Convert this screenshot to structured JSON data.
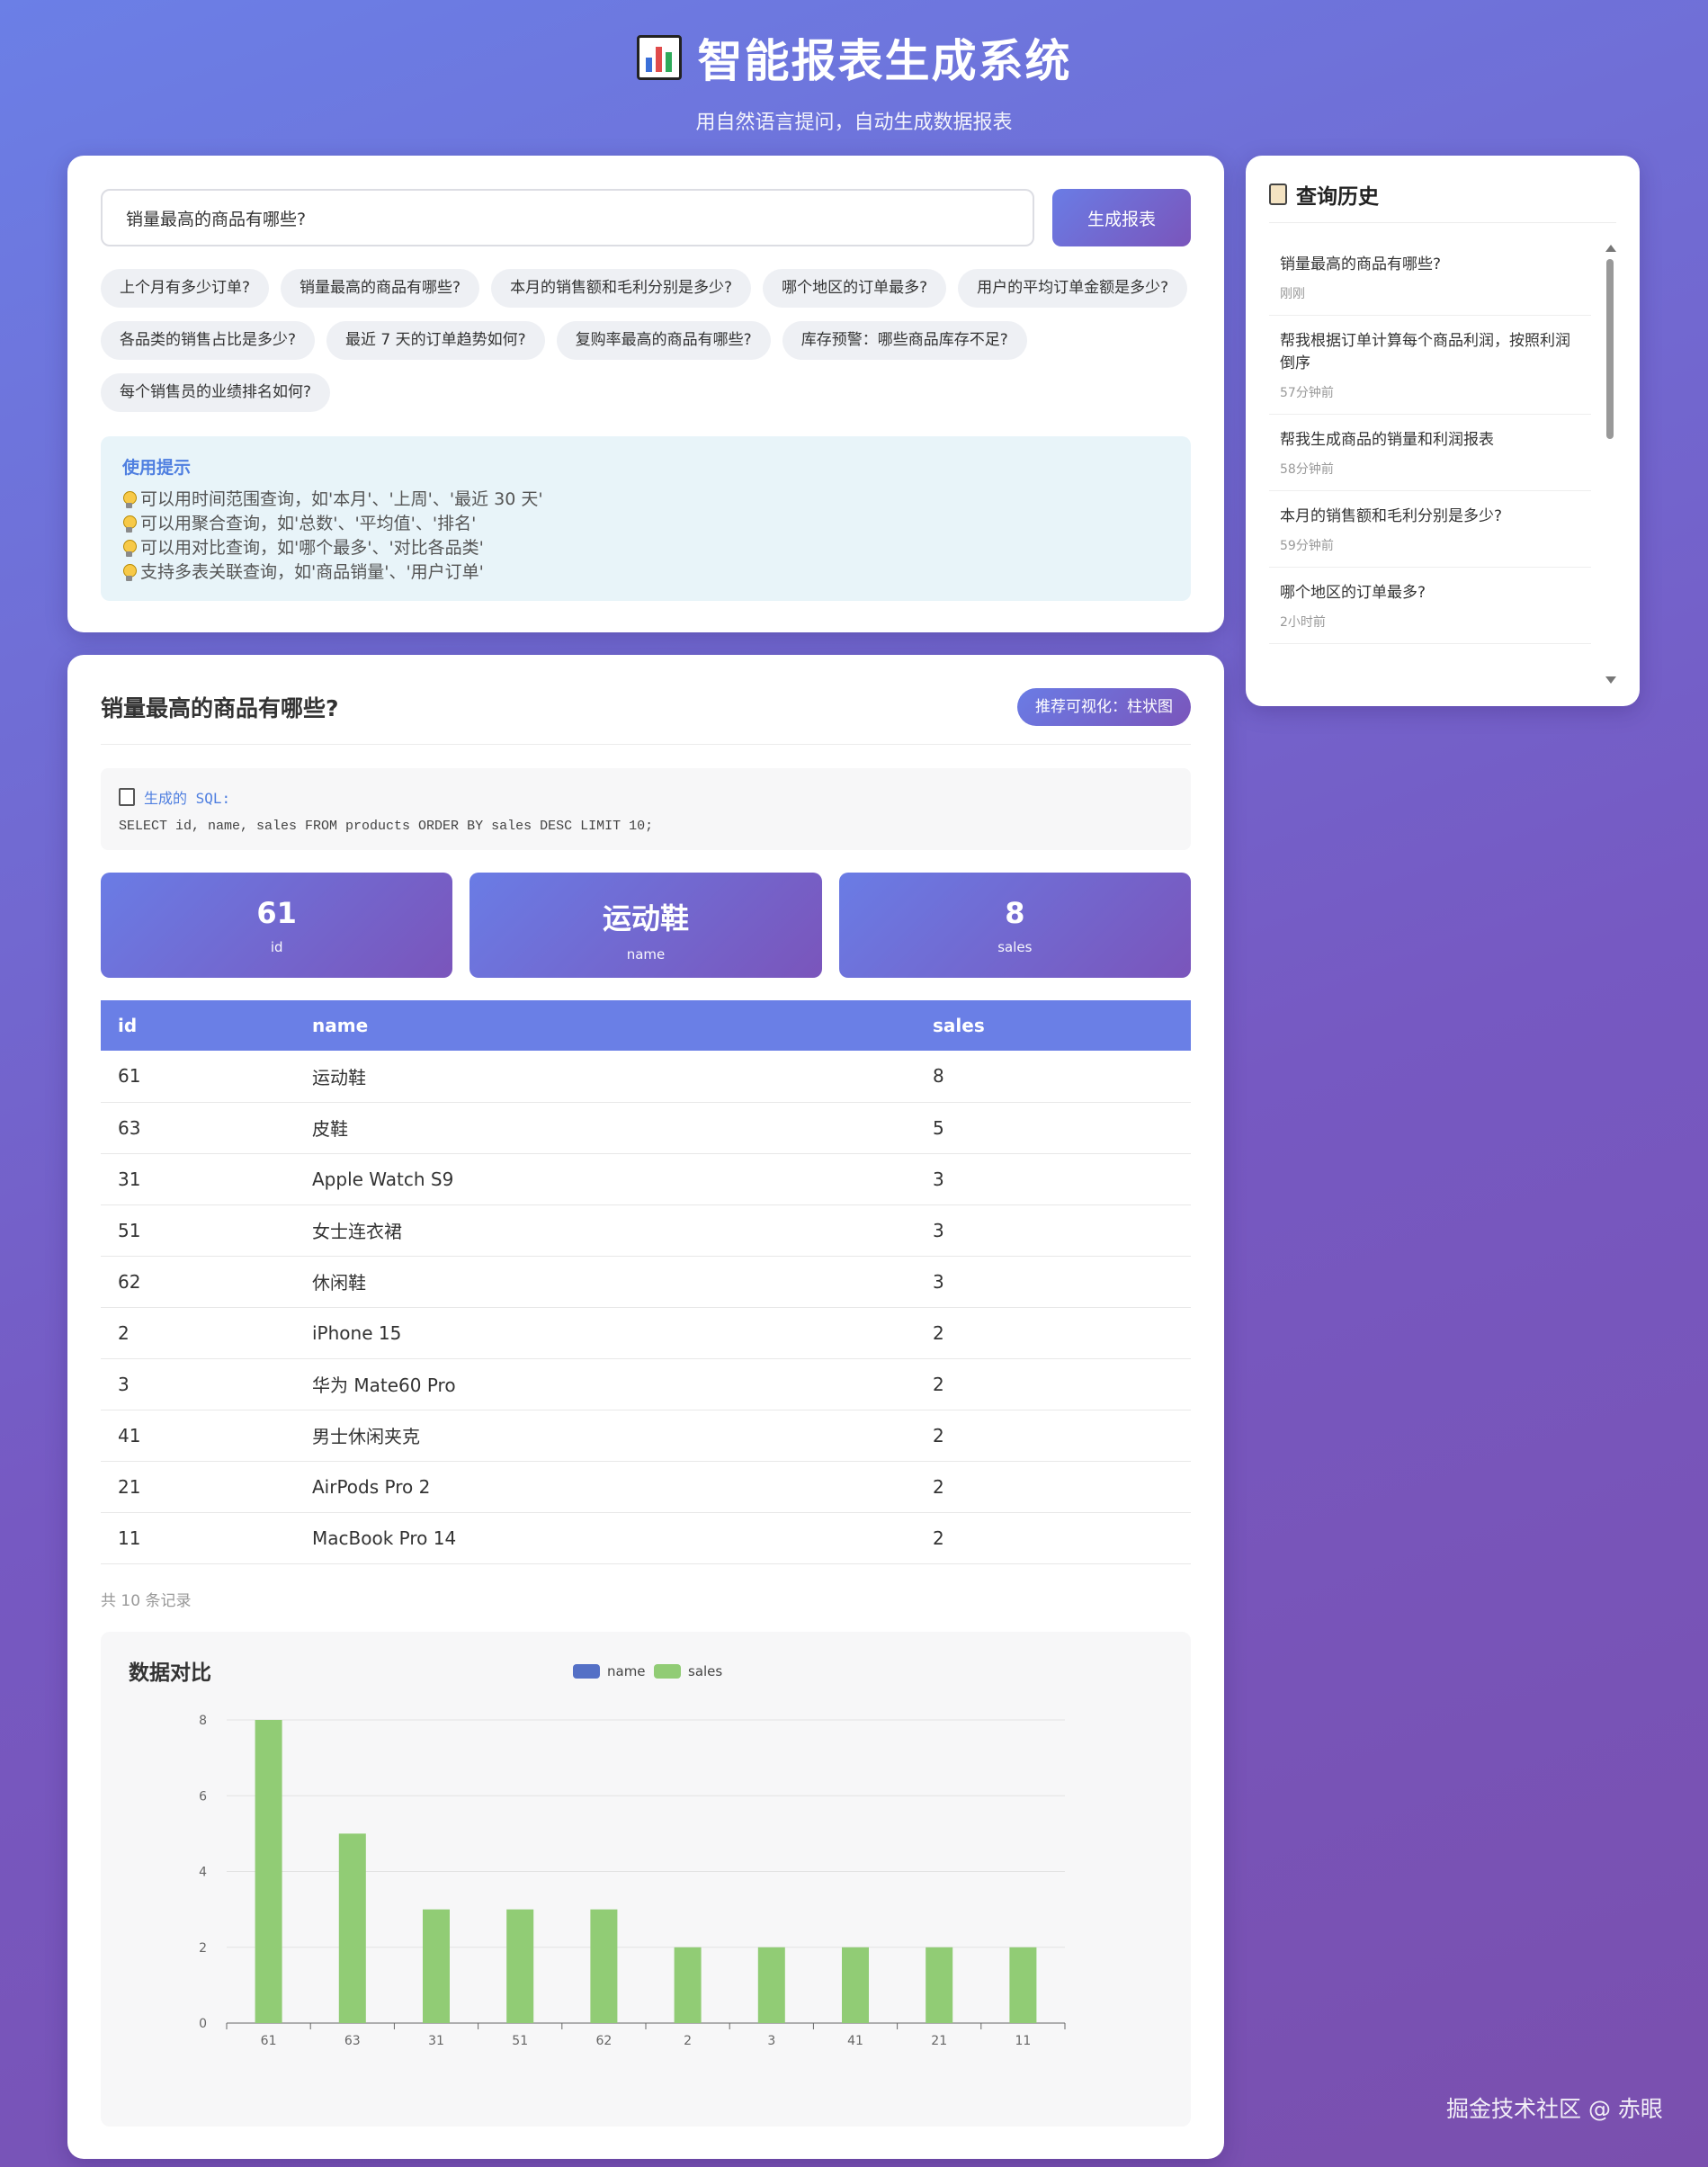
{
  "header": {
    "title": "智能报表生成系统",
    "subtitle": "用自然语言提问，自动生成数据报表"
  },
  "query": {
    "input_value": "销量最高的商品有哪些?",
    "generate_label": "生成报表",
    "suggestions": [
      "上个月有多少订单?",
      "销量最高的商品有哪些?",
      "本月的销售额和毛利分别是多少?",
      "哪个地区的订单最多?",
      "用户的平均订单金额是多少?",
      "各品类的销售占比是多少?",
      "最近 7 天的订单趋势如何?",
      "复购率最高的商品有哪些?",
      "库存预警：哪些商品库存不足?",
      "每个销售员的业绩排名如何?"
    ],
    "tips": {
      "title": "使用提示",
      "items": [
        "可以用时间范围查询，如'本月'、'上周'、'最近 30 天'",
        "可以用聚合查询，如'总数'、'平均值'、'排名'",
        "可以用对比查询，如'哪个最多'、'对比各品类'",
        "支持多表关联查询，如'商品销量'、'用户订单'"
      ]
    }
  },
  "history": {
    "title": "查询历史",
    "items": [
      {
        "question": "销量最高的商品有哪些?",
        "time": "刚刚"
      },
      {
        "question": "帮我根据订单计算每个商品利润，按照利润倒序",
        "time": "57分钟前"
      },
      {
        "question": "帮我生成商品的销量和利润报表",
        "time": "58分钟前"
      },
      {
        "question": "本月的销售额和毛利分别是多少?",
        "time": "59分钟前"
      },
      {
        "question": "哪个地区的订单最多?",
        "time": "2小时前"
      }
    ]
  },
  "result": {
    "title": "销量最高的商品有哪些?",
    "viz_badge": "推荐可视化：柱状图",
    "sql_label": "生成的 SQL:",
    "sql": "SELECT id, name, sales FROM products ORDER BY sales DESC LIMIT 10;",
    "stats": [
      {
        "value": "61",
        "key": "id"
      },
      {
        "value": "运动鞋",
        "key": "name"
      },
      {
        "value": "8",
        "key": "sales"
      }
    ],
    "table": {
      "columns": [
        "id",
        "name",
        "sales"
      ],
      "rows": [
        [
          "61",
          "运动鞋",
          "8"
        ],
        [
          "63",
          "皮鞋",
          "5"
        ],
        [
          "31",
          "Apple Watch S9",
          "3"
        ],
        [
          "51",
          "女士连衣裙",
          "3"
        ],
        [
          "62",
          "休闲鞋",
          "3"
        ],
        [
          "2",
          "iPhone 15",
          "2"
        ],
        [
          "3",
          "华为 Mate60 Pro",
          "2"
        ],
        [
          "41",
          "男士休闲夹克",
          "2"
        ],
        [
          "21",
          "AirPods Pro 2",
          "2"
        ],
        [
          "11",
          "MacBook Pro 14",
          "2"
        ]
      ]
    },
    "record_count": "共 10 条记录"
  },
  "chart_data": {
    "type": "bar",
    "title": "数据对比",
    "categories": [
      "61",
      "63",
      "31",
      "51",
      "62",
      "2",
      "3",
      "41",
      "21",
      "11"
    ],
    "series": [
      {
        "name": "name",
        "values": [],
        "color": "#5470c6"
      },
      {
        "name": "sales",
        "values": [
          8,
          5,
          3,
          3,
          3,
          2,
          2,
          2,
          2,
          2
        ],
        "color": "#91cc75"
      }
    ],
    "ylim": [
      0,
      8
    ],
    "yticks": [
      0,
      2,
      4,
      6,
      8
    ],
    "legend": "top-center",
    "grid": true
  },
  "watermark": "掘金技术社区 @ 赤眼",
  "colors": {
    "accent": "#6a7fe6",
    "accent_end": "#7a55bb",
    "tip_title": "#4f7fe0",
    "bar": "#91cc75"
  }
}
